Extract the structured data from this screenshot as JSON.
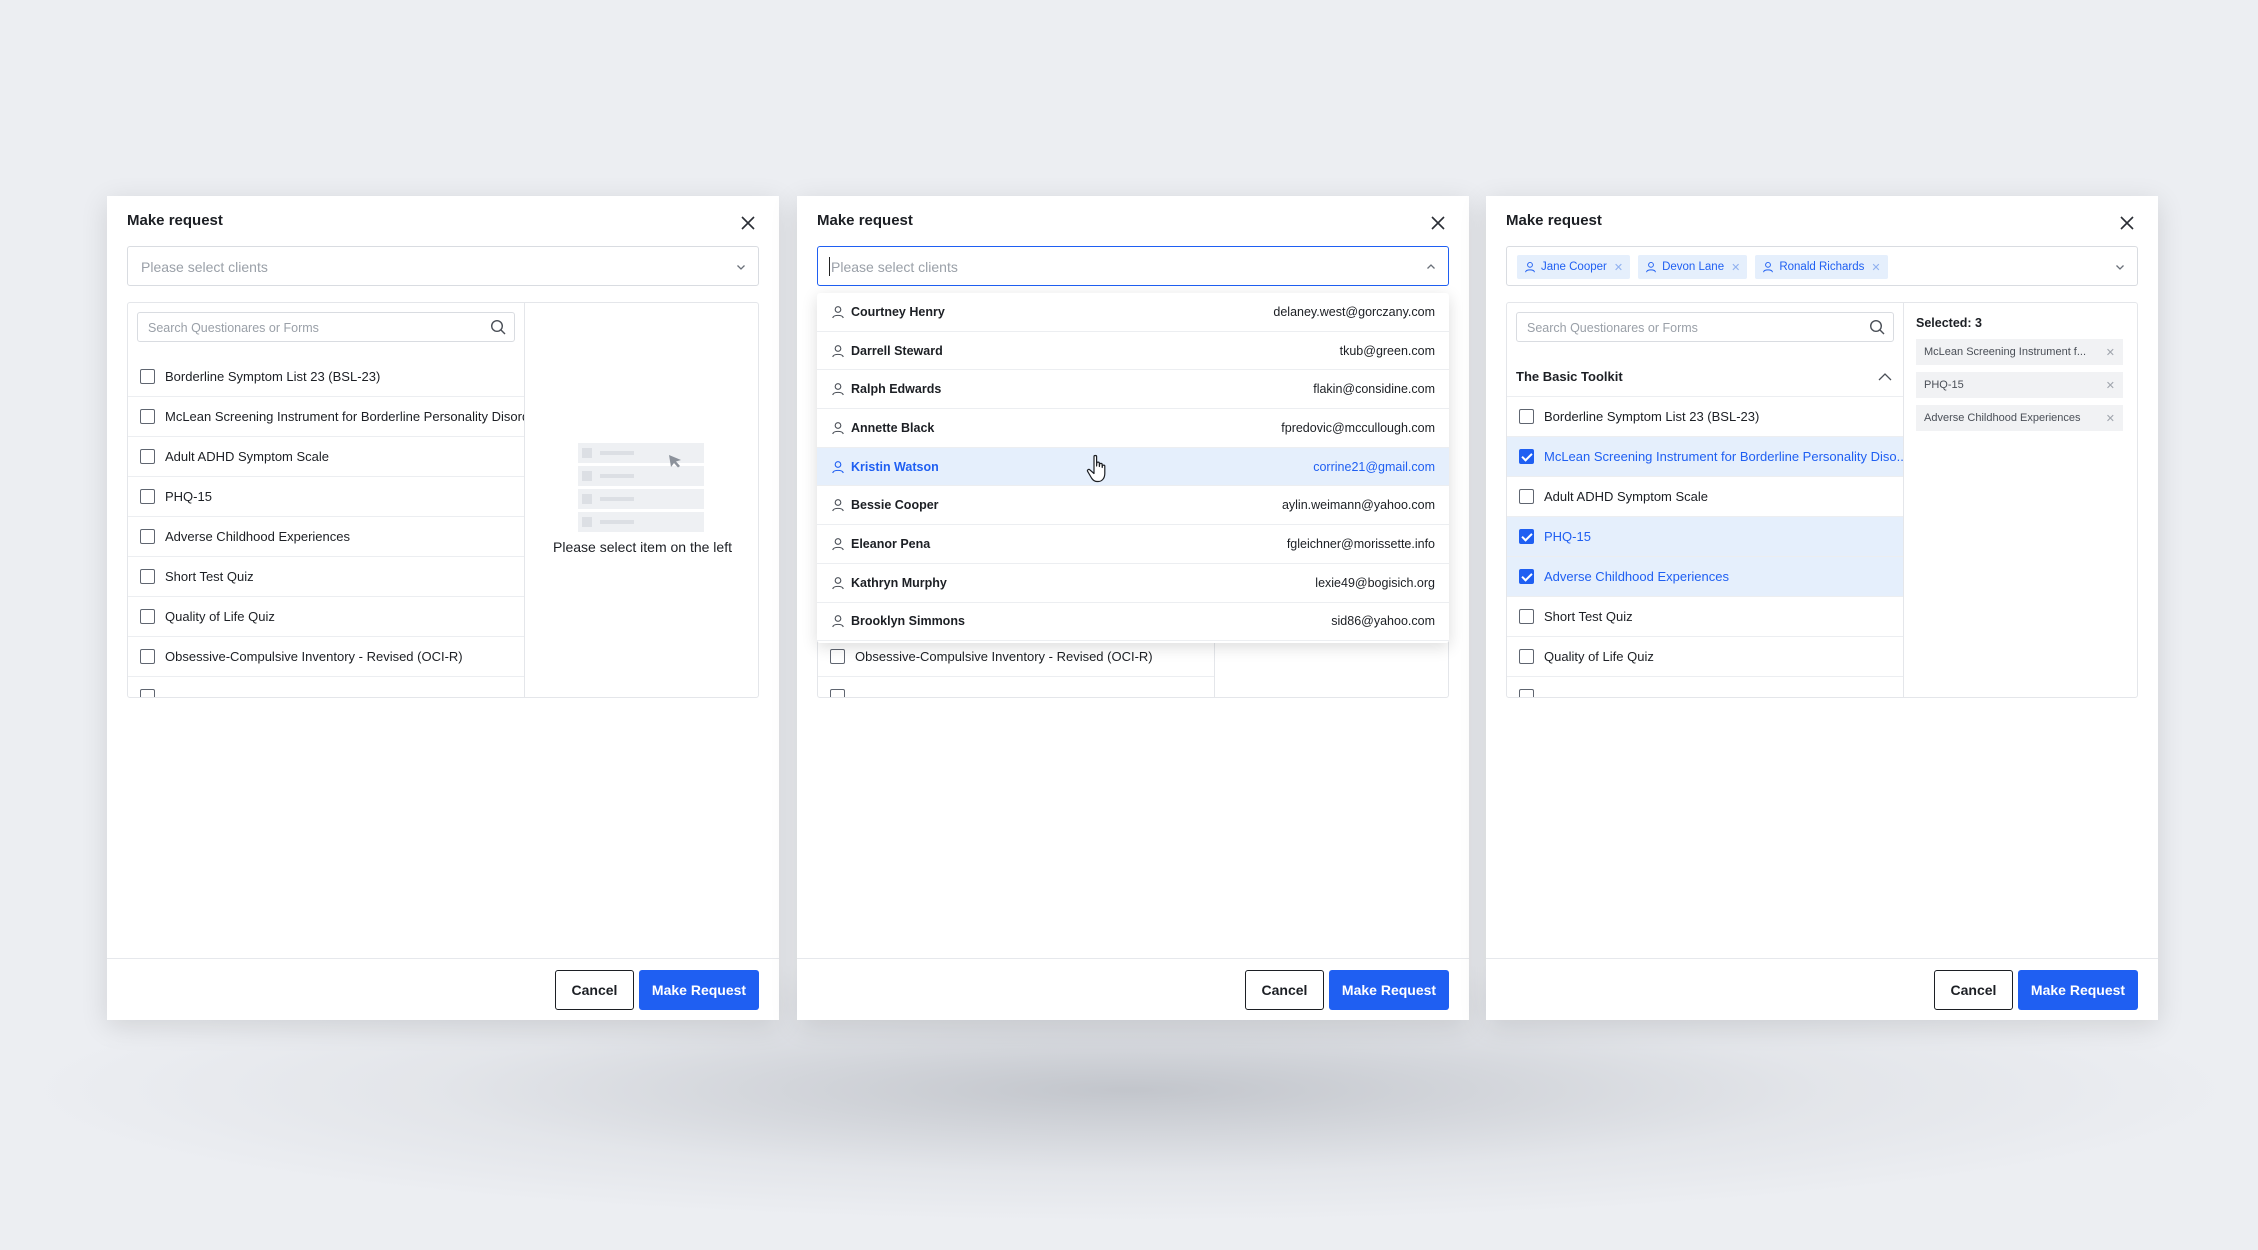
{
  "modal_title": "Make request",
  "client_placeholder": "Please select clients",
  "search_placeholder": "Search Questionares or Forms",
  "cancel_label": "Cancel",
  "make_request_label": "Make Request",
  "empty_state_text": "Please select item on the left",
  "questionnaires": [
    "Borderline Symptom List 23 (BSL-23)",
    "McLean Screening Instrument for Borderline Personality Disorder",
    "Adult ADHD Symptom Scale",
    "PHQ-15",
    "Adverse Childhood Experiences",
    "Short Test Quiz",
    "Quality of Life Quiz",
    "Obsessive-Compulsive Inventory - Revised (OCI-R)"
  ],
  "clients": [
    {
      "name": "Courtney Henry",
      "email": "delaney.west@gorczany.com"
    },
    {
      "name": "Darrell Steward",
      "email": "tkub@green.com"
    },
    {
      "name": "Ralph Edwards",
      "email": "flakin@considine.com"
    },
    {
      "name": "Annette Black",
      "email": "fpredovic@mccullough.com"
    },
    {
      "name": "Kristin Watson",
      "email": "corrine21@gmail.com"
    },
    {
      "name": "Bessie Cooper",
      "email": "aylin.weimann@yahoo.com"
    },
    {
      "name": "Eleanor Pena",
      "email": "fgleichner@morissette.info"
    },
    {
      "name": "Kathryn Murphy",
      "email": "lexie49@bogisich.org"
    },
    {
      "name": "Brooklyn Simmons",
      "email": "sid86@yahoo.com"
    }
  ],
  "modal2_visible_rows": [
    "Obsessive-Compulsive Inventory - Revised (OCI-R)"
  ],
  "selected_clients": [
    "Jane Cooper",
    "Devon Lane",
    "Ronald Richards"
  ],
  "toolkit_title": "The Basic Toolkit",
  "toolkit_items": [
    {
      "label": "Borderline Symptom List 23 (BSL-23)",
      "checked": false
    },
    {
      "label": "McLean Screening Instrument for Borderline Personality Diso...",
      "checked": true
    },
    {
      "label": "Adult ADHD Symptom Scale",
      "checked": false
    },
    {
      "label": "PHQ-15",
      "checked": true
    },
    {
      "label": "Adverse Childhood Experiences",
      "checked": true
    },
    {
      "label": "Short Test Quiz",
      "checked": false
    },
    {
      "label": "Quality of Life Quiz",
      "checked": false
    }
  ],
  "selected_count_label": "Selected: 3",
  "selected_items": [
    "McLean Screening Instrument f...",
    "PHQ-15",
    "Adverse Childhood Experiences"
  ],
  "colors": {
    "accent": "#1f5ff2",
    "selected_bg": "#e5effc"
  }
}
